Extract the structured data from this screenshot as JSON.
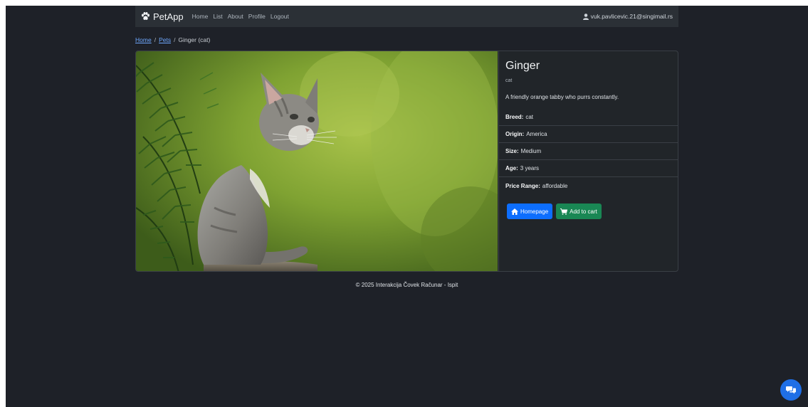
{
  "navbar": {
    "brand": "PetApp",
    "links": [
      "Home",
      "List",
      "About",
      "Profile",
      "Logout"
    ],
    "user_email": "vuk.pavlicevic.21@singimail.rs"
  },
  "breadcrumb": {
    "items": [
      "Home",
      "Pets"
    ],
    "current": "Ginger (cat)"
  },
  "pet": {
    "name": "Ginger",
    "type": "cat",
    "description": "A friendly orange tabby who purrs constantly.",
    "attributes": [
      {
        "label": "Breed:",
        "value": "cat"
      },
      {
        "label": "Origin:",
        "value": "America"
      },
      {
        "label": "Size:",
        "value": "Medium"
      },
      {
        "label": "Age:",
        "value": "3 years"
      },
      {
        "label": "Price Range:",
        "value": "affordable"
      }
    ]
  },
  "actions": {
    "homepage_label": "Homepage",
    "add_to_cart_label": "Add to cart"
  },
  "footer": {
    "text": "© 2025 Interakcija Čovek Računar - Ispit"
  },
  "colors": {
    "background": "#1e2128",
    "navbar": "#2b3036",
    "primary": "#0d6efd",
    "success": "#198754",
    "link": "#6ea8fe"
  },
  "icons": [
    "paw-icon",
    "user-icon",
    "home-icon",
    "cart-icon",
    "chat-icon"
  ]
}
